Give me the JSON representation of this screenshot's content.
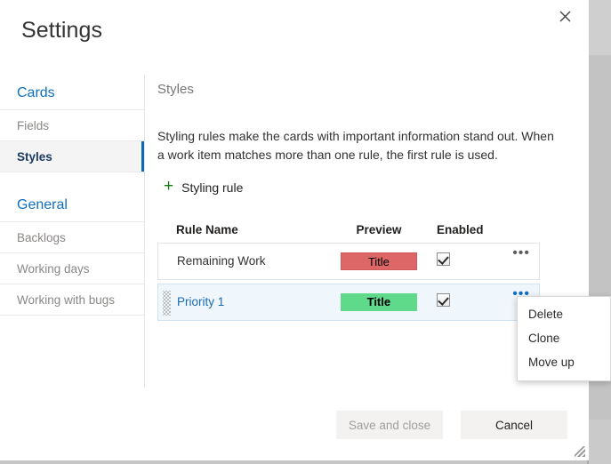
{
  "dialog": {
    "title": "Settings",
    "close_label": "Close"
  },
  "sidebar": {
    "groups": [
      {
        "header": "Cards",
        "items": [
          {
            "label": "Fields",
            "selected": false
          },
          {
            "label": "Styles",
            "selected": true
          }
        ]
      },
      {
        "header": "General",
        "items": [
          {
            "label": "Backlogs",
            "selected": false
          },
          {
            "label": "Working days",
            "selected": false
          },
          {
            "label": "Working with bugs",
            "selected": false
          }
        ]
      }
    ]
  },
  "main": {
    "section_title": "Styles",
    "description": "Styling rules make the cards with important information stand out. When a work item matches more than one rule, the first rule is used.",
    "add_rule_label": "Styling rule",
    "add_rule_icon": "plus-icon",
    "table": {
      "columns": [
        "Rule Name",
        "Preview",
        "Enabled"
      ],
      "rows": [
        {
          "name": "Remaining Work",
          "preview_text": "Title",
          "preview_color": "#dd6666",
          "enabled": true,
          "selected": false
        },
        {
          "name": "Priority 1",
          "preview_text": "Title",
          "preview_color": "#5fd98a",
          "enabled": true,
          "selected": true
        }
      ]
    }
  },
  "context_menu": {
    "items": [
      "Delete",
      "Clone",
      "Move up"
    ]
  },
  "footer": {
    "save_label": "Save and close",
    "cancel_label": "Cancel"
  },
  "colors": {
    "accent": "#0c69b7",
    "link": "#106ebe",
    "plus_green": "#107c10",
    "row_selected": "#eff6fc"
  }
}
